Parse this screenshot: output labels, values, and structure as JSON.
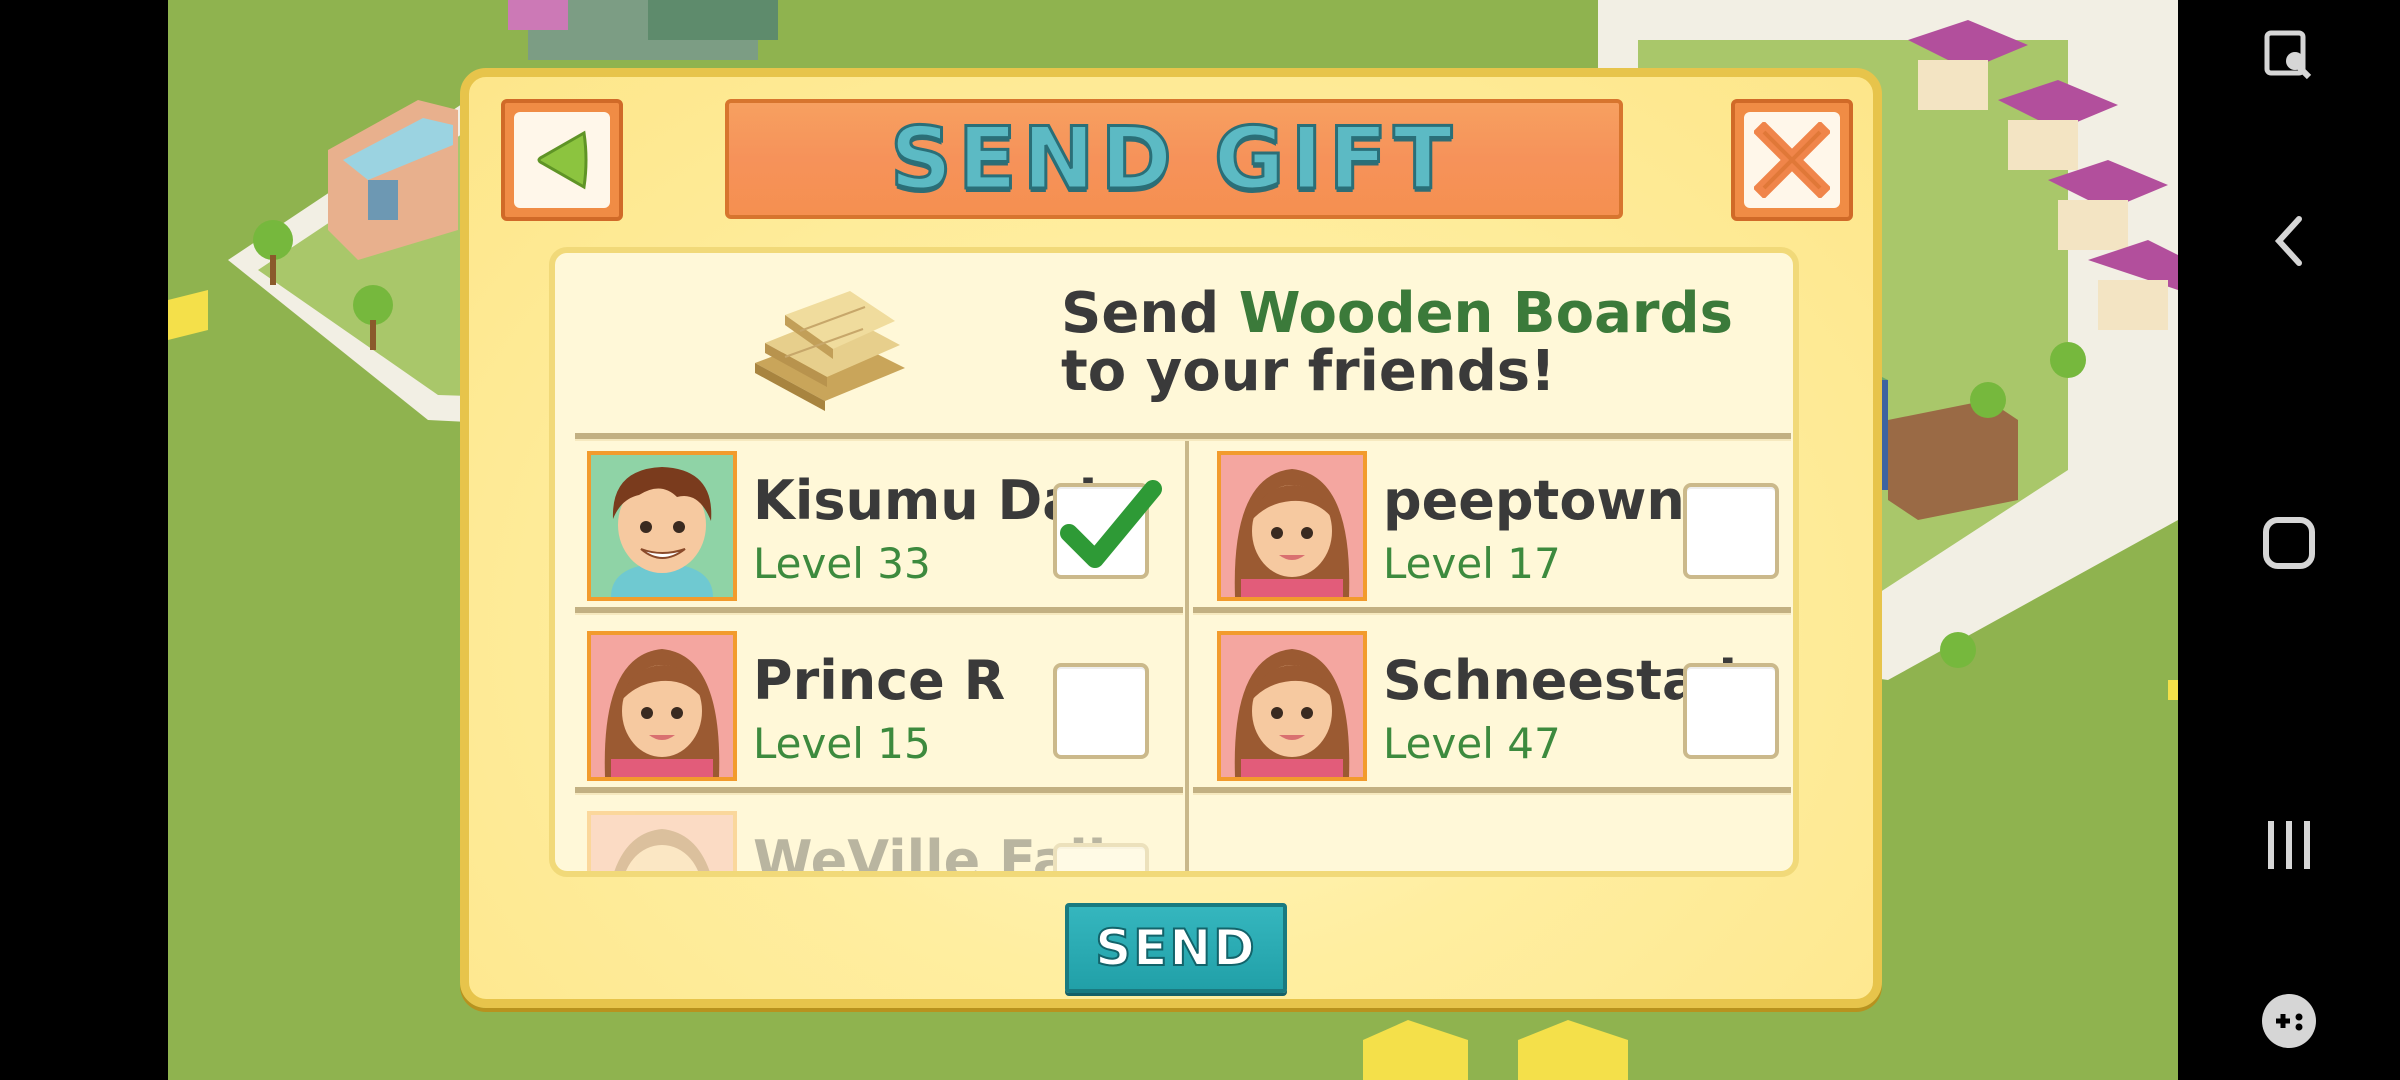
{
  "dialog": {
    "title": "SEND GIFT",
    "gift_prefix": "Send ",
    "gift_item": "Wooden Boards",
    "gift_suffix": "to your friends!",
    "send_label": "SEND"
  },
  "friends": [
    {
      "name": "Kisumu Dala",
      "level": "Level 33",
      "checked": true,
      "avatar": "boy-avatar"
    },
    {
      "name": "peeptown",
      "level": "Level 17",
      "checked": false,
      "avatar": "girl-avatar"
    },
    {
      "name": "Prince R",
      "level": "Level 15",
      "checked": false,
      "avatar": "girl-avatar"
    },
    {
      "name": "Schneestad",
      "level": "Level 47",
      "checked": false,
      "avatar": "girl-avatar"
    },
    {
      "name": "WeVille Falls",
      "level": "",
      "checked": false,
      "avatar": "girl-avatar"
    }
  ],
  "icons": {
    "back": "back-arrow-icon",
    "close": "close-x-icon",
    "gift": "wooden-boards-icon"
  },
  "colors": {
    "title_bar": "#f6925a",
    "title_text": "#5cbac4",
    "send_button": "#21a0a8",
    "level_green": "#3d8a3e",
    "check_green": "#2e9a36"
  }
}
